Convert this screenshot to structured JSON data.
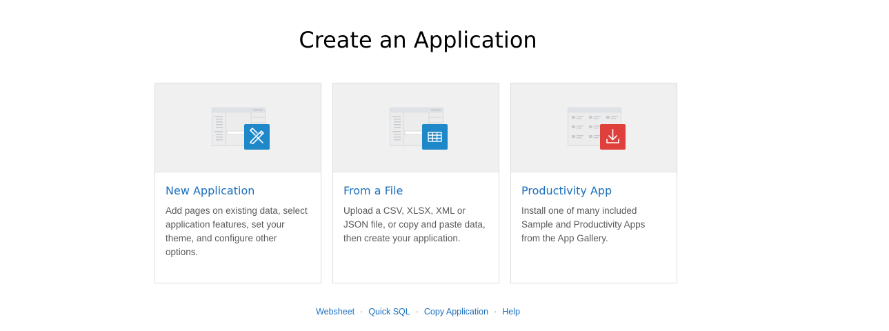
{
  "page": {
    "title": "Create an Application"
  },
  "cards": [
    {
      "title": "New Application",
      "description": "Add pages on existing data, select application features, set your theme, and configure other options.",
      "icon": "pencil-ruler-icon",
      "icon_color": "#1e88c9"
    },
    {
      "title": "From a File",
      "description": "Upload a CSV, XLSX, XML or JSON file, or copy and paste data, then create your application.",
      "icon": "table-grid-icon",
      "icon_color": "#1e88c9"
    },
    {
      "title": "Productivity App",
      "description": "Install one of many included Sample and Productivity Apps from the App Gallery.",
      "icon": "download-icon",
      "icon_color": "#e0403c"
    }
  ],
  "footer": {
    "links": [
      "Websheet",
      "Quick SQL",
      "Copy Application",
      "Help"
    ],
    "separator": "·"
  },
  "colors": {
    "link": "#1a6fbd",
    "hero_bg": "#f0f0f1"
  }
}
